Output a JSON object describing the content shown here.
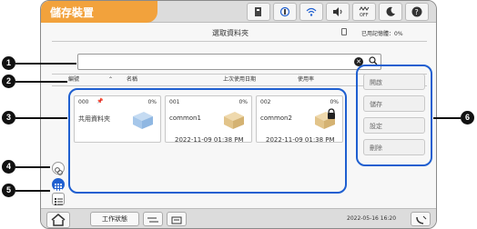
{
  "app": {
    "title": "儲存裝置"
  },
  "header": {
    "title": "選取資料夾",
    "memory_used": "已用記憶體：0%"
  },
  "search": {
    "value": "",
    "placeholder": ""
  },
  "columns": [
    "編號",
    "名稱",
    "上次使用日期",
    "使用率"
  ],
  "folders": [
    {
      "number": "000",
      "percent": "0%",
      "name": "共用資料夾",
      "date": ""
    },
    {
      "number": "001",
      "percent": "0%",
      "name": "common1",
      "date": "2022-11-09 01:38 PM"
    },
    {
      "number": "002",
      "percent": "0%",
      "name": "common2",
      "date": "2022-11-09 01:38 PM"
    }
  ],
  "actions": [
    "開啟",
    "儲存",
    "設定",
    "刪除"
  ],
  "footer": {
    "job_status": "工作狀態",
    "datetime": "2022-05-16 16:20"
  },
  "callouts": [
    "1",
    "2",
    "3",
    "4",
    "5",
    "6"
  ],
  "status_icons": [
    "storage-icon",
    "ink-icon",
    "wifi-icon",
    "volume-icon",
    "wifi-direct-off-icon",
    "sleep-icon",
    "help-icon"
  ],
  "wifi_off_label": "OFF",
  "colors": {
    "accent": "#f2a23c",
    "highlight": "#1f5fd0"
  }
}
